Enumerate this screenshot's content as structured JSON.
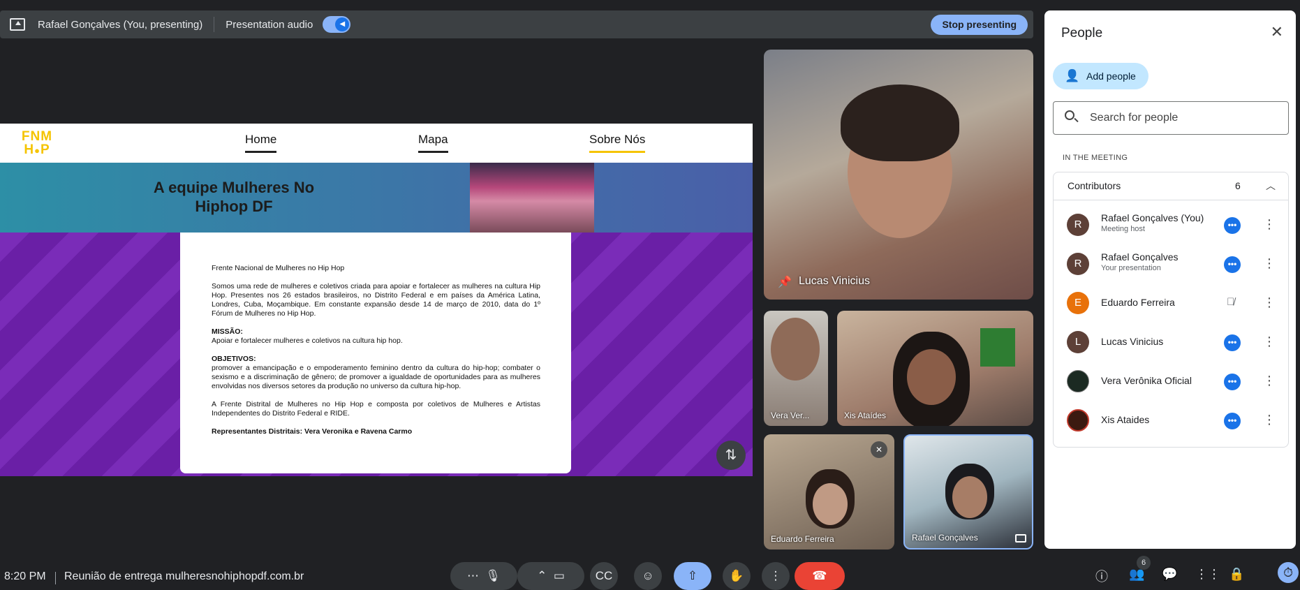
{
  "topbar": {
    "presenter_label": "Rafael Gonçalves (You, presenting)",
    "audio_label": "Presentation audio",
    "stop_button": "Stop presenting"
  },
  "presentation": {
    "logo": "FNM\nH●P",
    "nav": [
      "Home",
      "Mapa",
      "Sobre Nós"
    ],
    "hero_title": "A equipe Mulheres No Hiphop DF",
    "card": {
      "heading": "Frente Nacional de Mulheres no Hip Hop",
      "intro": "Somos uma rede de mulheres e coletivos criada para apoiar e fortalecer as mulheres na cultura Hip Hop. Presentes nos 26 estados brasileiros, no Distrito Federal e em países da América Latina, Londres, Cuba, Moçambique. Em constante expansão desde 14 de março de 2010, data do 1º Fórum de Mulheres no Hip Hop.",
      "mission_title": "MISSÃO:",
      "mission_text": "Apoiar e fortalecer mulheres e coletivos na cultura hip hop.",
      "objectives_title": "OBJETIVOS:",
      "objectives_text": "promover a emancipação e o empoderamento feminino dentro da cultura do hip-hop; combater o sexismo e a discriminação de gênero; de promover a igualdade de oportunidades para as mulheres envolvidas nos diversos setores da produção no universo da cultura hip-hop.",
      "district_text": "A Frente Distrital de Mulheres no Hip Hop e composta por coletivos de Mulheres e Artistas Independentes do Distrito Federal e RIDE.",
      "representatives": "Representantes Distritais: Vera Veronika e Ravena Carmo"
    }
  },
  "tiles": {
    "main": "Lucas Vinicius",
    "t2": "Vera Ver...",
    "t3": "Xis Ataídes",
    "t4": "Eduardo Ferreira",
    "t5": "Rafael Gonçalves"
  },
  "people": {
    "title": "People",
    "add_button": "Add people",
    "search_placeholder": "Search for people",
    "section": "IN THE MEETING",
    "group_label": "Contributors",
    "group_count": "6",
    "list": [
      {
        "initial": "R",
        "name": "Rafael Gonçalves (You)",
        "sub": "Meeting host",
        "color": "#5d4037"
      },
      {
        "initial": "R",
        "name": "Rafael Gonçalves",
        "sub": "Your presentation",
        "color": "#5d4037"
      },
      {
        "initial": "E",
        "name": "Eduardo Ferreira",
        "sub": "",
        "color": "#e8710a"
      },
      {
        "initial": "L",
        "name": "Lucas Vinicius",
        "sub": "",
        "color": "#5d4037"
      },
      {
        "initial": "",
        "name": "Vera Verônika Oficial",
        "sub": "",
        "color": "#1b2a22"
      },
      {
        "initial": "",
        "name": "Xis Ataides",
        "sub": "",
        "color": "#3b1a10"
      }
    ]
  },
  "bottom": {
    "time": "8:20 PM",
    "meeting_title": "Reunião de entrega mulheresnohiphopdf.com.br",
    "people_count": "6"
  }
}
